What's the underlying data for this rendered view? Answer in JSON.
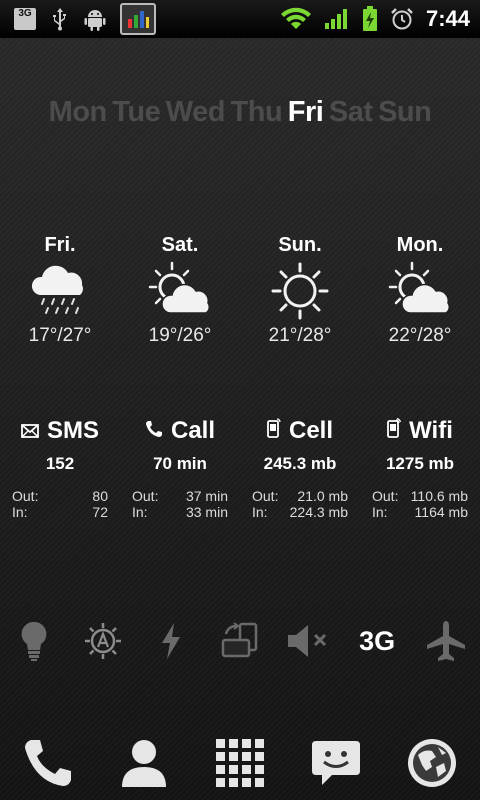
{
  "status_bar": {
    "badge": "3G",
    "time": "7:44"
  },
  "days": [
    "Mon",
    "Tue",
    "Wed",
    "Thu",
    "Fri",
    "Sat",
    "Sun"
  ],
  "forecast": [
    {
      "day": "Fri.",
      "temp": "17°/27°",
      "icon": "rain-icon"
    },
    {
      "day": "Sat.",
      "temp": "19°/26°",
      "icon": "partly-cloudy-icon"
    },
    {
      "day": "Sun.",
      "temp": "21°/28°",
      "icon": "sun-icon"
    },
    {
      "day": "Mon.",
      "temp": "22°/28°",
      "icon": "partly-cloudy-icon"
    }
  ],
  "usage": [
    {
      "label": "SMS",
      "icon": "envelope-icon",
      "total": "152",
      "out_label": "Out:",
      "out": "80",
      "in_label": "In:",
      "in": "72"
    },
    {
      "label": "Call",
      "icon": "phone-icon",
      "total": "70 min",
      "out_label": "Out:",
      "out": "37 min",
      "in_label": "In:",
      "in": "33 min"
    },
    {
      "label": "Cell",
      "icon": "cell-data-icon",
      "total": "245.3 mb",
      "out_label": "Out:",
      "out": "21.0 mb",
      "in_label": "In:",
      "in": "224.3 mb"
    },
    {
      "label": "Wifi",
      "icon": "wifi-data-icon",
      "total": "1275 mb",
      "out_label": "Out:",
      "out": "110.6 mb",
      "in_label": "In:",
      "in": "1164 mb"
    }
  ],
  "toggles": {
    "network_label": "3G",
    "icons": [
      "flashlight-icon",
      "auto-brightness-icon",
      "flash-icon",
      "rotation-icon",
      "mute-icon",
      "airplane-icon"
    ]
  },
  "dock": {
    "icons": [
      "phone-icon",
      "contacts-icon",
      "app-drawer-icon",
      "messaging-icon",
      "browser-icon"
    ]
  },
  "colors": {
    "active_day": "#ffffff",
    "inactive_day": "#4c4c4c",
    "signal_green": "#7bd832"
  }
}
